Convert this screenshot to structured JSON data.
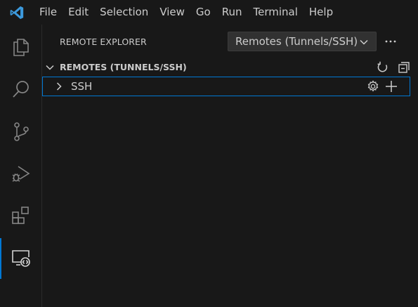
{
  "menu": {
    "items": [
      "File",
      "Edit",
      "Selection",
      "View",
      "Go",
      "Run",
      "Terminal",
      "Help"
    ]
  },
  "activity_bar": {
    "items": [
      {
        "icon": "files-icon"
      },
      {
        "icon": "search-icon"
      },
      {
        "icon": "source-control-icon"
      },
      {
        "icon": "run-debug-icon"
      },
      {
        "icon": "extensions-icon"
      },
      {
        "icon": "remote-explorer-icon",
        "active": true
      }
    ]
  },
  "sidebar": {
    "title": "REMOTE EXPLORER",
    "remote_select": {
      "value": "Remotes (Tunnels/SSH)"
    },
    "section": {
      "title": "REMOTES (TUNNELS/SSH)"
    },
    "tree": [
      {
        "label": "SSH"
      }
    ]
  },
  "colors": {
    "background": "#181818",
    "accent": "#0078d4",
    "logo": "#3c99dc",
    "text": "#cccccc"
  }
}
